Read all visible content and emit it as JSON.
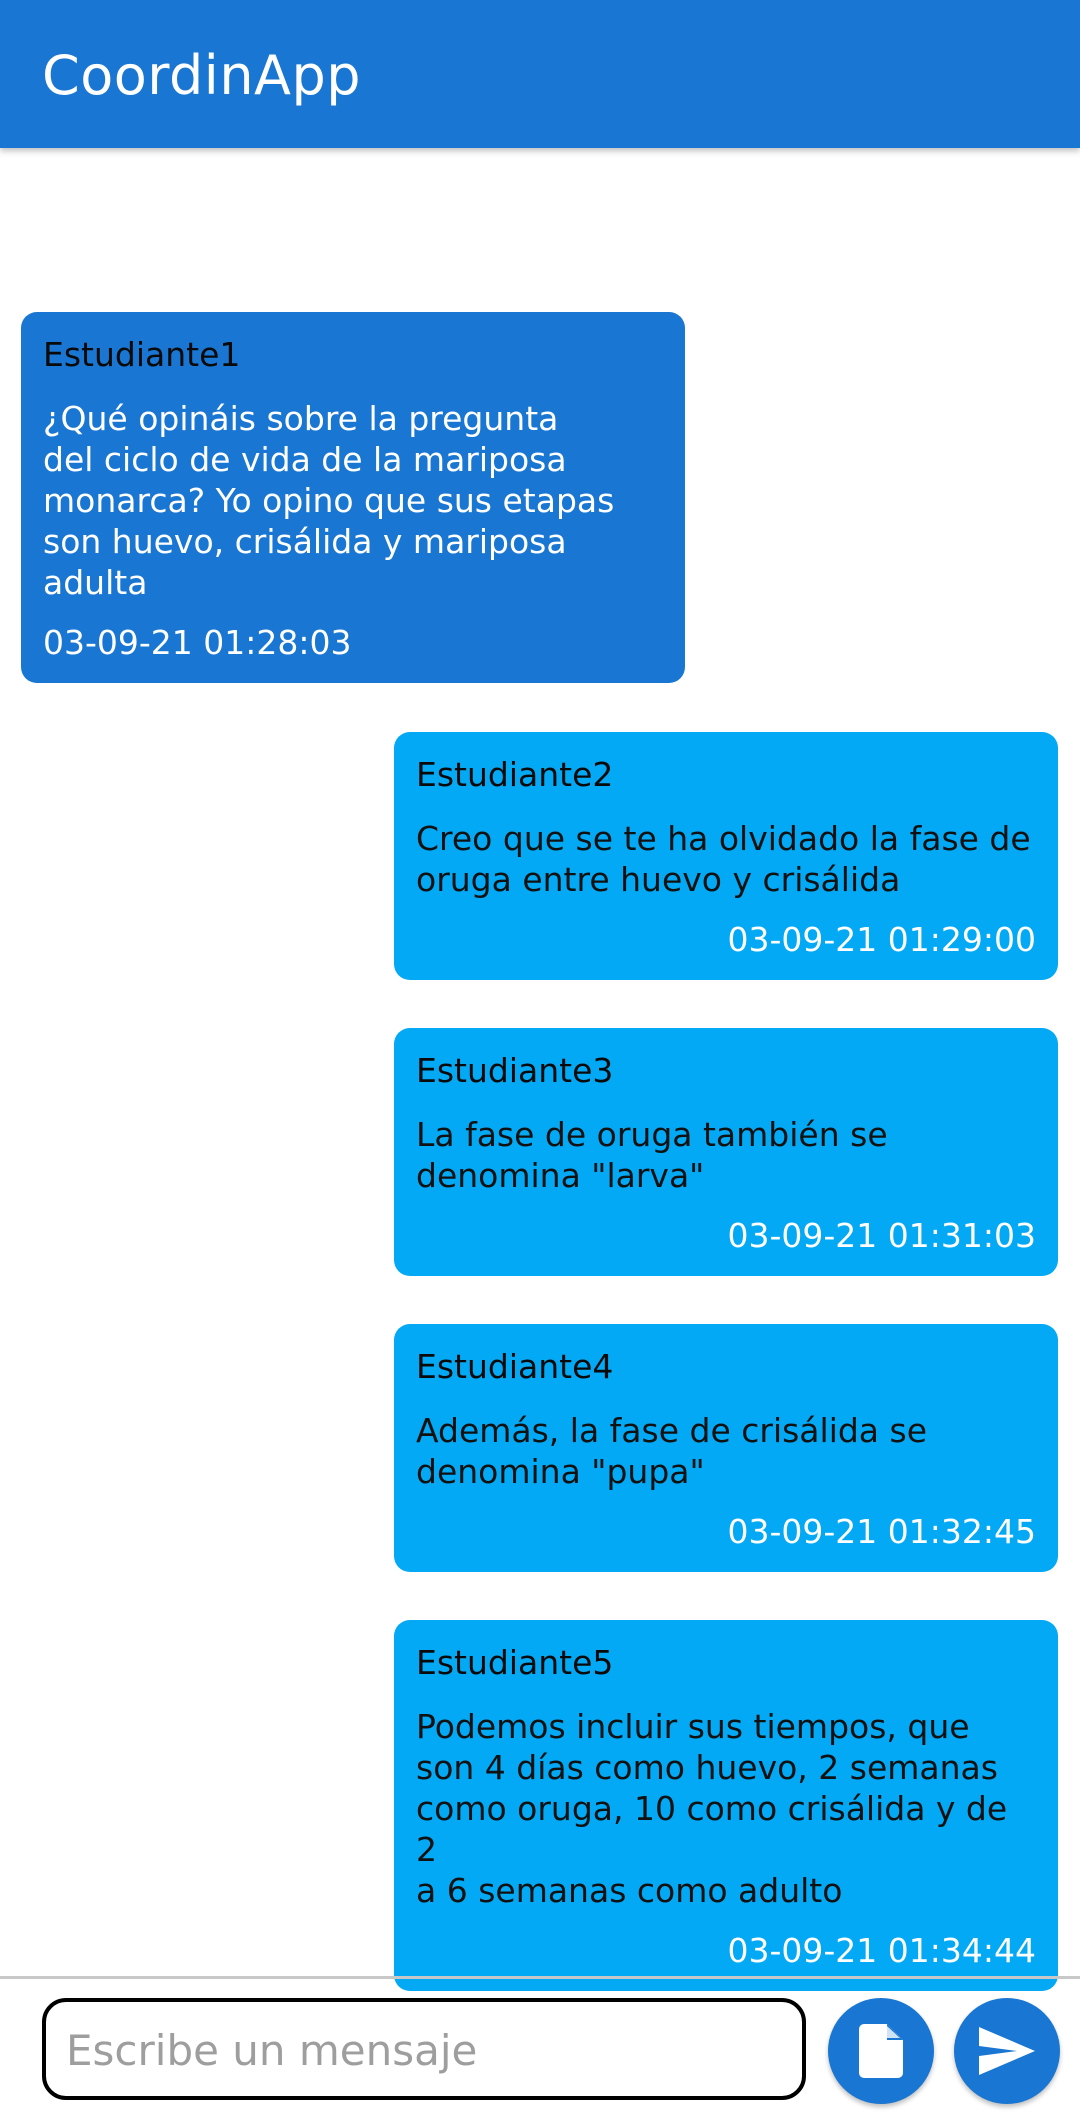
{
  "appbar": {
    "title": "CoordinApp"
  },
  "messages": [
    {
      "sender": "Estudiante1",
      "text": "¿Qué opináis sobre la pregunta\ndel ciclo de vida de la mariposa\nmonarca? Yo opino que sus etapas\nson huevo, crisálida y mariposa\nadulta",
      "timestamp": "03-09-21 01:28:03",
      "side": "left"
    },
    {
      "sender": "Estudiante2",
      "text": "Creo que se te ha olvidado la fase de\noruga entre huevo y crisálida",
      "timestamp": "03-09-21 01:29:00",
      "side": "right"
    },
    {
      "sender": "Estudiante3",
      "text": "La fase de oruga también se\ndenomina \"larva\"",
      "timestamp": "03-09-21 01:31:03",
      "side": "right"
    },
    {
      "sender": "Estudiante4",
      "text": "Además, la fase de crisálida se\ndenomina \"pupa\"",
      "timestamp": "03-09-21 01:32:45",
      "side": "right"
    },
    {
      "sender": "Estudiante5",
      "text": "Podemos incluir sus tiempos, que\nson 4 días como huevo, 2 semanas\ncomo oruga, 10 como crisálida y de 2\na 6 semanas como adulto",
      "timestamp": "03-09-21 01:34:44",
      "side": "right"
    }
  ],
  "composer": {
    "placeholder": "Escribe un mensaje",
    "value": "",
    "attach_icon": "file-icon",
    "send_icon": "send-icon"
  },
  "colors": {
    "primary": "#1976d2",
    "own_bubble": "#1976d2",
    "other_bubble": "#03a9f4"
  }
}
